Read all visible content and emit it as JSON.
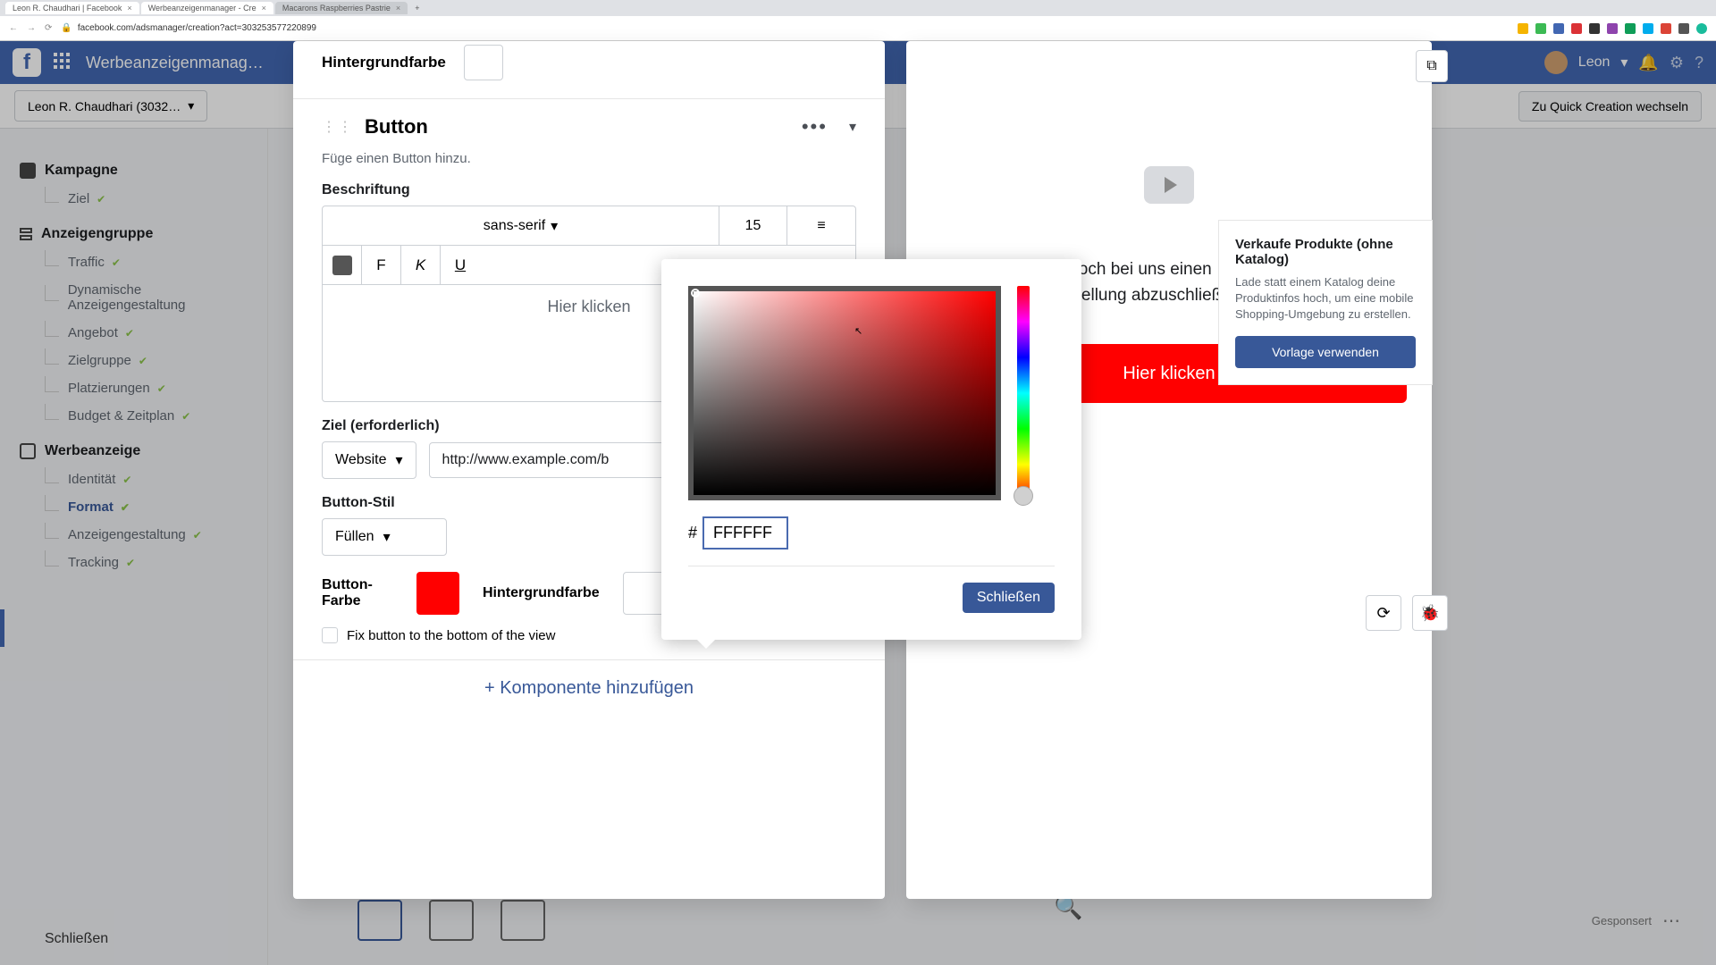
{
  "browser": {
    "tabs": [
      {
        "title": "Leon R. Chaudhari | Facebook"
      },
      {
        "title": "Werbeanzeigenmanager - Cre"
      },
      {
        "title": "Macarons Raspberries Pastrie"
      }
    ],
    "url": "facebook.com/adsmanager/creation?act=303253577220899"
  },
  "header": {
    "product": "Werbeanzeigenmanag…",
    "user_name": "Leon",
    "account_selector": "Leon R. Chaudhari (3032…",
    "quick_switch": "Zu Quick Creation wechseln"
  },
  "leftnav": {
    "groups": {
      "campaign": {
        "label": "Kampagne",
        "items": [
          {
            "label": "Ziel",
            "done": true
          }
        ]
      },
      "adset": {
        "label": "Anzeigengruppe",
        "items": [
          {
            "label": "Traffic",
            "done": true
          },
          {
            "label": "Dynamische Anzeigengestaltung",
            "done": false
          },
          {
            "label": "Angebot",
            "done": true
          },
          {
            "label": "Zielgruppe",
            "done": true
          },
          {
            "label": "Platzierungen",
            "done": true
          },
          {
            "label": "Budget & Zeitplan",
            "done": true
          }
        ]
      },
      "ad": {
        "label": "Werbeanzeige",
        "items": [
          {
            "label": "Identität",
            "done": true
          },
          {
            "label": "Format",
            "done": true,
            "active": true
          },
          {
            "label": "Anzeigengestaltung",
            "done": true
          },
          {
            "label": "Tracking",
            "done": true
          }
        ]
      }
    },
    "close": "Schließen"
  },
  "editor": {
    "prev_section_label": "Hintergrundfarbe",
    "button_section": {
      "title": "Button",
      "intro": "Füge einen Button hinzu.",
      "caption_label": "Beschriftung",
      "font": "sans-serif",
      "font_size": "15",
      "style_f": "F",
      "style_k": "K",
      "style_u": "U",
      "text_value": "Hier klicken",
      "target_label": "Ziel (erforderlich)",
      "target_type": "Website",
      "target_url": "http://www.example.com/b",
      "style_label": "Button-Stil",
      "style_value": "Füllen",
      "button_color_label": "Button-Farbe",
      "bg_color_label": "Hintergrundfarbe",
      "fix_bottom": "Fix button to the bottom of the view"
    },
    "add_component": "+ Komponente hinzufügen"
  },
  "preview": {
    "card_title": "Verkaufe Produkte (ohne Katalog)",
    "card_body": "Lade statt einem Katalog deine Produktinfos hoch, um eine mobile Shopping-Umgebung zu erstellen.",
    "card_cta": "Vorlage verwenden",
    "body_text": "… wenn du heute noch bei uns einen … Klicken unten auf den Link, um deine … stellung abzuschließen.",
    "button_text": "Hier klicken"
  },
  "picker": {
    "hex": "FFFFFF",
    "close": "Schließen"
  },
  "bg": {
    "sponsor": "Gesponsert"
  }
}
